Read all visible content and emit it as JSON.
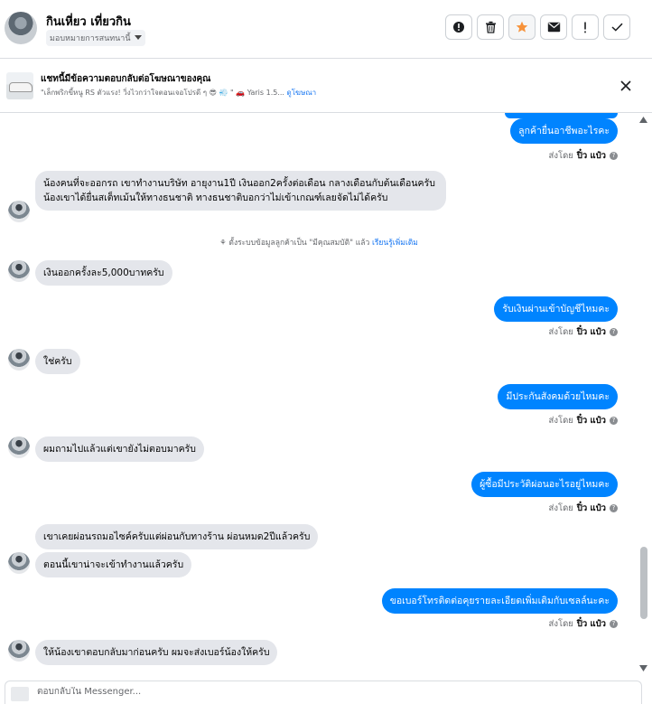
{
  "header": {
    "contact_name": "กินเหี่ยว เที่ยวกิน",
    "assign_label": "มอบหมายการสนทนานี้",
    "toolbar": [
      "report-icon",
      "trash-icon",
      "star-icon",
      "mail-icon",
      "exclamation-icon",
      "check-icon"
    ],
    "star_color": "#f7923a"
  },
  "banner": {
    "title": "แชทนี้มีข้อความตอบกลับต่อโฆษณาของคุณ",
    "subtitle": "\"เล็กพริกขี้หนู RS ตัวแรง! วิ่งไวกว่าใจตอนเจอโปรดี ๆ 😎 💨 \" 🚗 Yaris 1.5...",
    "link": "ดูโฆษณา"
  },
  "messages": {
    "m1": "ลูกค้ายื่นอาชีพอะไรคะ",
    "sent_by_label": "ส่งโดย",
    "sender": "ปิ๋ว แป๋ว",
    "m2": "น้องคนที่จะออกรถ เขาทำงานบริษัท อายุงาน1ปี เงินออก2ครั้งต่อเดือน กลางเดือนกับต้นเดือนครับ น้องเขาได้ยื่นสเต็ทเม้นให้ทางธนชาติ ทางธนชาติบอกว่าไม่เข้าเกณฑ์เลยจัดไม่ได้ครับ",
    "note_text": "ตั้งระบบข้อมูลลูกค้าเป็น \"มีคุณสมบัติ\" แล้ว",
    "note_link": "เรียนรู้เพิ่มเติม",
    "m3": "เงินออกครั้งละ5,000บาทครับ",
    "m4": "รับเงินผ่านเข้าบัญชีไหมคะ",
    "m5": "ใช่ครับ",
    "m6": "มีประกันสังคมด้วยไหมคะ",
    "m7": "ผมถามไปแล้วแต่เขายังไม่ตอบมาครับ",
    "m8": "ผู้ซื้อมีประวัติผ่อนอะไรอยู่ไหมคะ",
    "m9": "เขาเคยผ่อนรถมอไซค์ครับแต่ผ่อนกับทางร้าน ผ่อนหมด2ปีแล้วครับ",
    "m10": "ตอนนี้เขาน่าจะเข้าทำงานแล้วครับ",
    "m11": "ขอเบอร์โทรติดต่อคุยรายละเอียดเพิ่มเติมกับเซลล์นะคะ",
    "m12": "ให้น้องเขาตอบกลับมาก่อนครับ ผมจะส่งเบอร์น้องให้ครับ"
  },
  "composer": {
    "placeholder": "ตอบกลับใน Messenger..."
  },
  "colors": {
    "outgoing_bubble": "#0084ff",
    "incoming_bubble": "#e4e6eb",
    "link": "#1877f2"
  }
}
